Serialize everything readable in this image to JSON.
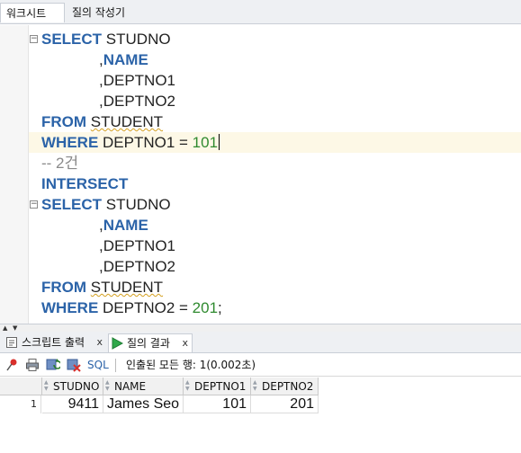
{
  "top_tabs": [
    "워크시트",
    "질의 작성기"
  ],
  "editor": {
    "lines": {
      "l1_kw": "SELECT",
      "l1_rest": " STUDNO",
      "l2_comma": ",",
      "l2_kw": "NAME",
      "l3_text": ",DEPTNO1",
      "l4_text": ",DEPTNO2",
      "l5_kw": "FROM",
      "l5_table": "STUDENT",
      "l6_kw": "WHERE",
      "l6_mid": " DEPTNO1 = ",
      "l6_num": "101",
      "l7_comment": "-- 2건",
      "l8_kw": "INTERSECT",
      "l9_kw": "SELECT",
      "l9_rest": " STUDNO",
      "l10_comma": ",",
      "l10_kw": "NAME",
      "l11_text": ",DEPTNO1",
      "l12_text": ",DEPTNO2",
      "l13_kw": "FROM",
      "l13_table": "STUDENT",
      "l14_kw": "WHERE",
      "l14_mid": " DEPTNO2 = ",
      "l14_num": "201",
      "l14_end": ";"
    }
  },
  "bottom_tabs": {
    "script_output": {
      "label": "스크립트 출력",
      "close": "x"
    },
    "query_result": {
      "label": "질의 결과",
      "close": "x"
    }
  },
  "result_toolbar": {
    "sql_label": "SQL",
    "status": "인출된 모든 행: 1(0.002초)"
  },
  "result_grid": {
    "columns": [
      "STUDNO",
      "NAME",
      "DEPTNO1",
      "DEPTNO2"
    ],
    "rows": [
      {
        "row_number": "1",
        "cells": [
          "9411",
          "James Seo",
          "101",
          "201"
        ]
      }
    ]
  },
  "colors": {
    "keyword": "#2b63a8",
    "number": "#2f8a2f",
    "comment": "#8a8a8a",
    "current_line": "#fdf8e6"
  },
  "icons": [
    "pin-icon",
    "print-icon",
    "refresh-icon",
    "delete-icon",
    "script-icon",
    "run-icon",
    "fold-icon"
  ]
}
